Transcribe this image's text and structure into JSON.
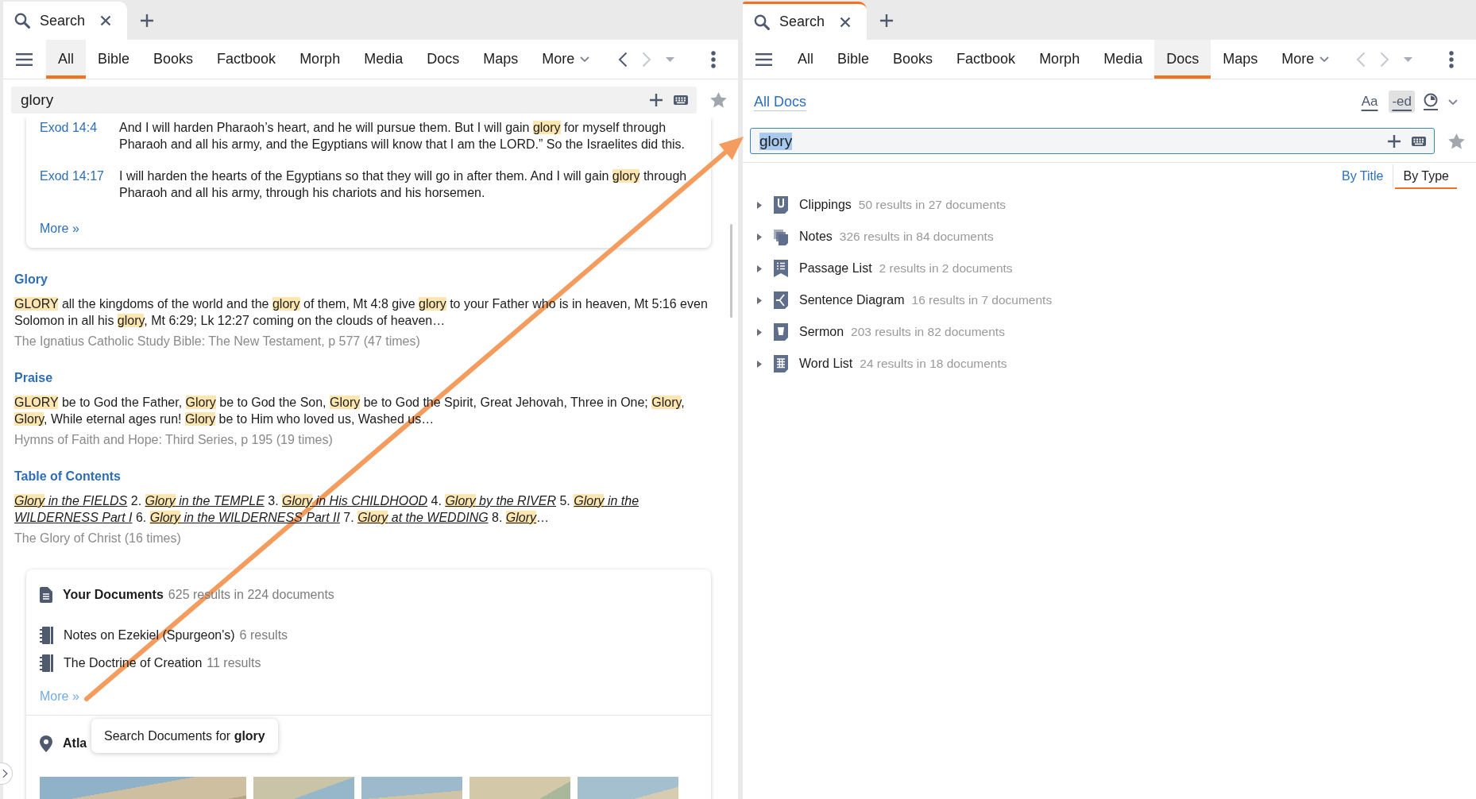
{
  "left_pane": {
    "tab": {
      "label": "Search",
      "focused": false
    },
    "nav": {
      "items": [
        {
          "label": "All",
          "selected": true
        },
        {
          "label": "Bible",
          "selected": false
        },
        {
          "label": "Books",
          "selected": false
        },
        {
          "label": "Factbook",
          "selected": false
        },
        {
          "label": "Morph",
          "selected": false
        },
        {
          "label": "Media",
          "selected": false
        },
        {
          "label": "Docs",
          "selected": false
        },
        {
          "label": "Maps",
          "selected": false
        }
      ],
      "more": "More",
      "back_disabled": false,
      "forward_disabled": true
    },
    "search": {
      "value": "glory",
      "focused": false,
      "text_selected": false
    },
    "passages": {
      "rows": [
        {
          "ref": "Exod 14:4",
          "segments": [
            {
              "text": "And I will harden Pharaoh’s heart, and he will pursue them. But I will gain ",
              "hit": false
            },
            {
              "text": "glory",
              "hit": true
            },
            {
              "text": " for myself through Pharaoh and all his army, and the Egyptians will know that I am the LORD.” So the Israelites did this.",
              "hit": false
            }
          ]
        },
        {
          "ref": "Exod 14:17",
          "segments": [
            {
              "text": "I will harden the hearts of the Egyptians so that they will go in after them. And I will gain ",
              "hit": false
            },
            {
              "text": "glory",
              "hit": true
            },
            {
              "text": " through Pharaoh and all his army, through his chariots and his horsemen.",
              "hit": false
            }
          ]
        }
      ],
      "more": {
        "label": "More »",
        "hovered": false
      }
    },
    "sections": [
      {
        "title": "Glory",
        "segments": [
          {
            "text": "GLORY",
            "hit": true
          },
          {
            "text": " all the kingdoms of the world and the ",
            "hit": false
          },
          {
            "text": "glory",
            "hit": true
          },
          {
            "text": " of them, Mt 4:8 give ",
            "hit": false
          },
          {
            "text": "glory",
            "hit": true
          },
          {
            "text": " to your Father who is in heaven, Mt 5:16 even Solomon in all his ",
            "hit": false
          },
          {
            "text": "glory",
            "hit": true
          },
          {
            "text": ", Mt 6:29; Lk 12:27 coming on the clouds of heaven…",
            "hit": false
          }
        ],
        "source": "The Ignatius Catholic Study Bible: The New Testament, p 577 (47 times)"
      },
      {
        "title": "Praise",
        "segments": [
          {
            "text": "GLORY",
            "hit": true
          },
          {
            "text": " be to God the Father, ",
            "hit": false
          },
          {
            "text": "Glory",
            "hit": true
          },
          {
            "text": " be to God the Son, ",
            "hit": false
          },
          {
            "text": "Glory",
            "hit": true
          },
          {
            "text": " be to God the Spirit, Great Jehovah, Three in One; ",
            "hit": false
          },
          {
            "text": "Glory",
            "hit": true
          },
          {
            "text": ", ",
            "hit": false
          },
          {
            "text": "Glory",
            "hit": true
          },
          {
            "text": ", While eternal ages run! ",
            "hit": false
          },
          {
            "text": "Glory",
            "hit": true
          },
          {
            "text": " be to Him who loved us, Washed us…",
            "hit": false
          }
        ],
        "source": "Hymns of Faith and Hope: Third Series, p 195 (19 times)"
      },
      {
        "title": "Table of Contents",
        "segments": [
          {
            "text": "Glory",
            "hit": true,
            "title": true
          },
          {
            "text": " in the FIELDS",
            "hit": false,
            "title": true
          },
          {
            "text": " 2. ",
            "hit": false,
            "title": false
          },
          {
            "text": "Glory",
            "hit": true,
            "title": true
          },
          {
            "text": " in the TEMPLE",
            "hit": false,
            "title": true
          },
          {
            "text": " 3. ",
            "hit": false,
            "title": false
          },
          {
            "text": "Glory",
            "hit": true,
            "title": true
          },
          {
            "text": " in His CHILDHOOD",
            "hit": false,
            "title": true
          },
          {
            "text": " 4. ",
            "hit": false,
            "title": false
          },
          {
            "text": "Glory",
            "hit": true,
            "title": true
          },
          {
            "text": " by the RIVER",
            "hit": false,
            "title": true
          },
          {
            "text": " 5. ",
            "hit": false,
            "title": false
          },
          {
            "text": "Glory",
            "hit": true,
            "title": true
          },
          {
            "text": " in the WILDERNESS Part I",
            "hit": false,
            "title": true
          },
          {
            "text": " 6. ",
            "hit": false,
            "title": false
          },
          {
            "text": "Glory",
            "hit": true,
            "title": true
          },
          {
            "text": " in the WILDERNESS Part II",
            "hit": false,
            "title": true
          },
          {
            "text": " 7. ",
            "hit": false,
            "title": false
          },
          {
            "text": "Glory",
            "hit": true,
            "title": true
          },
          {
            "text": " at the WEDDING",
            "hit": false,
            "title": true
          },
          {
            "text": " 8. ",
            "hit": false,
            "title": false
          },
          {
            "text": "Glory",
            "hit": true,
            "title": true
          },
          {
            "text": "…",
            "hit": false,
            "title": false
          }
        ],
        "source": "The Glory of Christ (16 times)"
      }
    ],
    "documents": {
      "title": "Your Documents",
      "summary": "625 results in 224 documents",
      "items": [
        {
          "title": "Notes on Ezekiel (Spurgeon's)",
          "count": "6 results"
        },
        {
          "title": "The Doctrine of Creation",
          "count": "11 results"
        }
      ],
      "more": {
        "label": "More »",
        "hovered": true
      }
    },
    "atlas": {
      "title": "Atla"
    },
    "tooltip": "Search Documents for **glory**"
  },
  "right_pane": {
    "tab": {
      "label": "Search",
      "focused": true
    },
    "nav": {
      "items": [
        {
          "label": "All",
          "selected": false
        },
        {
          "label": "Bible",
          "selected": false
        },
        {
          "label": "Books",
          "selected": false
        },
        {
          "label": "Factbook",
          "selected": false
        },
        {
          "label": "Morph",
          "selected": false
        },
        {
          "label": "Media",
          "selected": false
        },
        {
          "label": "Docs",
          "selected": true
        },
        {
          "label": "Maps",
          "selected": false
        }
      ],
      "more": "More",
      "back_disabled": true,
      "forward_disabled": true
    },
    "scope": "All Docs",
    "toggles": [
      {
        "label": "Aa",
        "on": false
      },
      {
        "label": "-ed",
        "on": true
      }
    ],
    "search": {
      "value": "glory",
      "focused": true,
      "text_selected": true
    },
    "views": [
      {
        "label": "By Title",
        "selected": false
      },
      {
        "label": "By Type",
        "selected": true
      }
    ],
    "groups": [
      {
        "kind": "clippings",
        "label": "Clippings",
        "summary": "50 results in 27 documents",
        "expanded": false
      },
      {
        "kind": "notes",
        "label": "Notes",
        "summary": "326 results in 84 documents",
        "expanded": false
      },
      {
        "kind": "passage_list",
        "label": "Passage List",
        "summary": "2 results in 2 documents",
        "expanded": false
      },
      {
        "kind": "sentence_diagram",
        "label": "Sentence Diagram",
        "summary": "16 results in 7 documents",
        "expanded": false
      },
      {
        "kind": "sermon",
        "label": "Sermon",
        "summary": "203 results in 82 documents",
        "expanded": false
      },
      {
        "kind": "word_list",
        "label": "Word List",
        "summary": "24 results in 18 documents",
        "expanded": false
      }
    ]
  }
}
